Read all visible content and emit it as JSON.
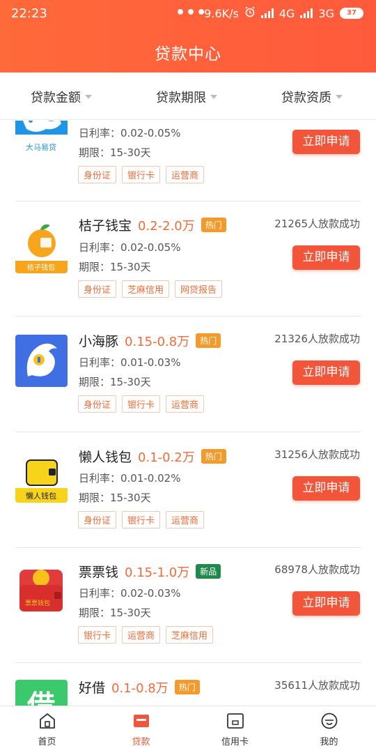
{
  "status": {
    "time": "22:23",
    "dots": "•••",
    "speed": "9.6K/s",
    "net1": "4G",
    "net2": "3G",
    "battery": "37"
  },
  "header": {
    "title": "贷款中心"
  },
  "filters": [
    "贷款金额",
    "贷款期限",
    "贷款资质"
  ],
  "loans": [
    {
      "name": "",
      "amount": "",
      "badge": "",
      "count": "",
      "rate": "日利率：0.02-0.05%",
      "term": "期限：15-30天",
      "tags": [
        "身份证",
        "银行卡",
        "运营商"
      ],
      "apply": "立即申请",
      "logo_text": "大马易贷",
      "logo_icon": "horse-logo-icon"
    },
    {
      "name": "桔子钱宝",
      "amount": "0.2-2.0万",
      "badge": "热门",
      "count": "21265人放款成功",
      "rate": "日利率：0.02-0.05%",
      "term": "期限：15-30天",
      "tags": [
        "身份证",
        "芝麻信用",
        "网贷报告"
      ],
      "apply": "立即申请",
      "logo_text": "桔子钱包",
      "logo_icon": "orange-logo-icon"
    },
    {
      "name": "小海豚",
      "amount": "0.15-0.8万",
      "badge": "热门",
      "count": "21326人放款成功",
      "rate": "日利率：0.01-0.03%",
      "term": "期限：15-30天",
      "tags": [
        "身份证",
        "银行卡",
        "运营商"
      ],
      "apply": "立即申请",
      "logo_text": "",
      "logo_icon": "dolphin-logo-icon"
    },
    {
      "name": "懒人钱包",
      "amount": "0.1-0.2万",
      "badge": "热门",
      "count": "31256人放款成功",
      "rate": "日利率：0.01-0.02%",
      "term": "期限：15-30天",
      "tags": [
        "身份证",
        "银行卡",
        "运营商"
      ],
      "apply": "立即申请",
      "logo_text": "懒人钱包",
      "logo_icon": "wallet-logo-icon"
    },
    {
      "name": "票票钱",
      "amount": "0.15-1.0万",
      "badge": "新品",
      "count": "68978人放款成功",
      "rate": "日利率：0.02-0.03%",
      "term": "期限：15-30天",
      "tags": [
        "银行卡",
        "运营商",
        "芝麻信用"
      ],
      "apply": "立即申请",
      "logo_text": "票票钱包",
      "logo_icon": "red-wallet-logo-icon"
    },
    {
      "name": "好借",
      "amount": "0.1-0.8万",
      "badge": "热门",
      "count": "35611人放款成功",
      "rate": "",
      "term": "",
      "tags": [],
      "apply": "",
      "logo_text": "借",
      "logo_icon": "green-logo-icon"
    }
  ],
  "tabs": [
    {
      "label": "首页",
      "icon": "home-icon"
    },
    {
      "label": "贷款",
      "icon": "loan-icon"
    },
    {
      "label": "信用卡",
      "icon": "credit-card-icon"
    },
    {
      "label": "我的",
      "icon": "profile-icon"
    }
  ],
  "colors": {
    "primary": "#f3553a",
    "accent": "#f36b36",
    "hot_badge": "#f39a2a",
    "new_badge": "#1f8a4c"
  }
}
